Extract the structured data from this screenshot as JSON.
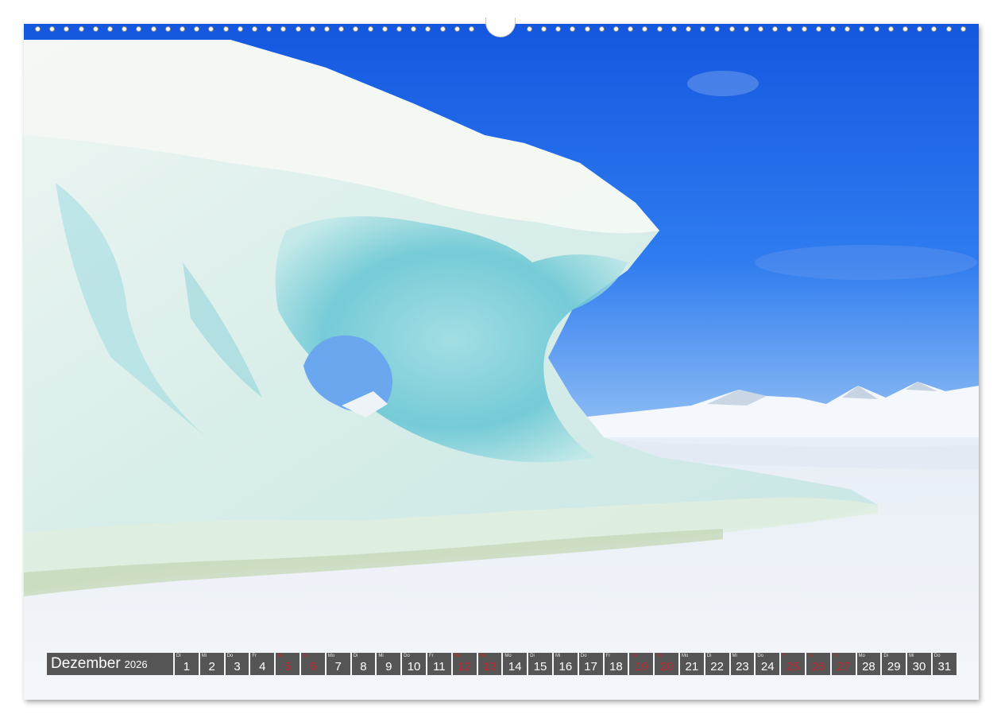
{
  "calendar": {
    "month": "Dezember",
    "year": "2026",
    "days": [
      {
        "wd": "Di",
        "num": "1",
        "weekend": false
      },
      {
        "wd": "Mi",
        "num": "2",
        "weekend": false
      },
      {
        "wd": "Do",
        "num": "3",
        "weekend": false
      },
      {
        "wd": "Fr",
        "num": "4",
        "weekend": false
      },
      {
        "wd": "Sa",
        "num": "5",
        "weekend": true
      },
      {
        "wd": "So",
        "num": "6",
        "weekend": true
      },
      {
        "wd": "Mo",
        "num": "7",
        "weekend": false
      },
      {
        "wd": "Di",
        "num": "8",
        "weekend": false
      },
      {
        "wd": "Mi",
        "num": "9",
        "weekend": false
      },
      {
        "wd": "Do",
        "num": "10",
        "weekend": false
      },
      {
        "wd": "Fr",
        "num": "11",
        "weekend": false
      },
      {
        "wd": "Sa",
        "num": "12",
        "weekend": true
      },
      {
        "wd": "So",
        "num": "13",
        "weekend": true
      },
      {
        "wd": "Mo",
        "num": "14",
        "weekend": false
      },
      {
        "wd": "Di",
        "num": "15",
        "weekend": false
      },
      {
        "wd": "Mi",
        "num": "16",
        "weekend": false
      },
      {
        "wd": "Do",
        "num": "17",
        "weekend": false
      },
      {
        "wd": "Fr",
        "num": "18",
        "weekend": false
      },
      {
        "wd": "Sa",
        "num": "19",
        "weekend": true
      },
      {
        "wd": "So",
        "num": "20",
        "weekend": true
      },
      {
        "wd": "Mo",
        "num": "21",
        "weekend": false
      },
      {
        "wd": "Di",
        "num": "22",
        "weekend": false
      },
      {
        "wd": "Mi",
        "num": "23",
        "weekend": false
      },
      {
        "wd": "Do",
        "num": "24",
        "weekend": false
      },
      {
        "wd": "Fr",
        "num": "25",
        "weekend": true
      },
      {
        "wd": "Sa",
        "num": "26",
        "weekend": true
      },
      {
        "wd": "So",
        "num": "27",
        "weekend": true
      },
      {
        "wd": "Mo",
        "num": "28",
        "weekend": false
      },
      {
        "wd": "Di",
        "num": "29",
        "weekend": false
      },
      {
        "wd": "Mi",
        "num": "30",
        "weekend": false
      },
      {
        "wd": "Do",
        "num": "31",
        "weekend": false
      }
    ]
  },
  "colors": {
    "bar": "#555555",
    "weekend": "#c0262d",
    "sky_top": "#1c63e6",
    "sky_bottom": "#7fb3f2",
    "ice": "#7fd3de"
  },
  "icons": {
    "binding": "wire-binding-holes",
    "hanger": "calendar-hanger-notch"
  }
}
